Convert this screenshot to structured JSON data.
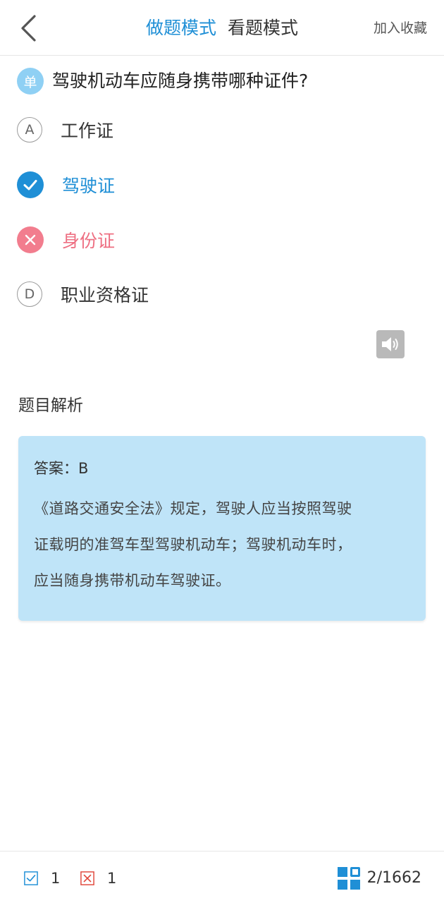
{
  "header": {
    "back_icon": "chevron-left-icon",
    "tabs": [
      {
        "label": "做题模式",
        "active": true
      },
      {
        "label": "看题模式",
        "active": false
      }
    ],
    "favorite_label": "加入收藏"
  },
  "question": {
    "type_badge": "单",
    "text": "驾驶机动车应随身携带哪种证件?"
  },
  "options": [
    {
      "letter": "A",
      "text": "工作证",
      "state": "normal"
    },
    {
      "letter": "B",
      "text": "驾驶证",
      "state": "correct"
    },
    {
      "letter": "C",
      "text": "身份证",
      "state": "wrong"
    },
    {
      "letter": "D",
      "text": "职业资格证",
      "state": "normal"
    }
  ],
  "speaker_icon": "speaker-icon",
  "analysis": {
    "title": "题目解析",
    "answer": "答案：B",
    "lines": [
      "《道路交通安全法》规定，驾驶人应当按照驾驶",
      "证载明的准驾车型驾驶机动车；驾驶机动车时，",
      "应当随身携带机动车驾驶证。"
    ]
  },
  "footer": {
    "correct_count": "1",
    "wrong_count": "1",
    "progress": "2/1662"
  },
  "colors": {
    "accent": "#1f8fd6",
    "wrong": "#f27d8e",
    "card_bg": "#bfe4f8"
  }
}
